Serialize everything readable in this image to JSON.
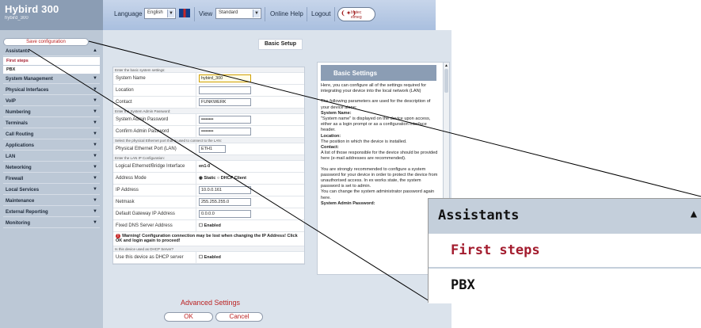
{
  "brand": {
    "title": "Hybird 300",
    "subtitle": "hybird_300"
  },
  "topbar": {
    "language_label": "Language",
    "language_value": "English",
    "view_label": "View",
    "view_value": "Standard",
    "online_help": "Online Help",
    "logout": "Logout",
    "logo_text": "bintec elmeg"
  },
  "sidebar": {
    "save_label": "Save configuration",
    "items": [
      {
        "label": "Assistants",
        "expanded": true
      },
      {
        "label": "System Management"
      },
      {
        "label": "Physical Interfaces"
      },
      {
        "label": "VoIP"
      },
      {
        "label": "Numbering"
      },
      {
        "label": "Terminals"
      },
      {
        "label": "Call Routing"
      },
      {
        "label": "Applications"
      },
      {
        "label": "LAN"
      },
      {
        "label": "Networking"
      },
      {
        "label": "Firewall"
      },
      {
        "label": "Local Services"
      },
      {
        "label": "Maintenance"
      },
      {
        "label": "External Reporting"
      },
      {
        "label": "Monitoring"
      }
    ],
    "subitems": [
      {
        "label": "First steps",
        "active": true
      },
      {
        "label": "PBX"
      }
    ]
  },
  "content": {
    "title": "Basic Setup",
    "section_system": "Enter the basic system settings:",
    "system_name_label": "System Name",
    "system_name_value": "hybird_300",
    "location_label": "Location",
    "location_value": "",
    "contact_label": "Contact",
    "contact_value": "FUNKWERK",
    "section_admin": "Enter the System Admin Password:",
    "admin_pw_label": "System Admin Password",
    "admin_pw_value": "••••••••",
    "confirm_pw_label": "Confirm Admin Password",
    "confirm_pw_value": "••••••••",
    "section_port": "Select the physical Ethernet port that is used to connect to the LAN:",
    "port_label": "Physical Ethernet Port (LAN)",
    "port_value": "ETH1",
    "section_lan": "Enter the LAN IP Configuration:",
    "bridge_label": "Logical Ethernet/Bridge Interface",
    "bridge_value": "en1-0",
    "address_mode_label": "Address Mode",
    "static_label": "Static",
    "dhcp_label": "DHCP Client",
    "ip_label": "IP Address",
    "ip_value": "10.0.0.161",
    "netmask_label": "Netmask",
    "netmask_value": "255.255.255.0",
    "gateway_label": "Default Gateway IP Address",
    "gateway_value": "0.0.0.0",
    "dns_label": "Fixed DNS Server Address",
    "dns_enabled": "Enabled",
    "warning": "Warning! Configuration connection may be lost when changing the IP Address! Click OK and login again to proceed!",
    "section_dhcp": "Is this device used as DHCP Server?",
    "dhcp_server_label": "Use this device as DHCP server",
    "dhcp_server_enabled": "Enabled",
    "advanced": "Advanced Settings",
    "ok": "OK",
    "cancel": "Cancel"
  },
  "help": {
    "title": "Basic Settings",
    "p1": "Here, you can configure all of the settings required for integrating your device into the local network (LAN)",
    "p2": "The following parameters are used for the description of your device alone:",
    "h_sysname": "System Name:",
    "p3": "\"System name\" is displayed on the device upon access, either as a login prompt or as a configuration interface header.",
    "h_location": "Location:",
    "p4": "The position in which the device is installed.",
    "h_contact": "Contact:",
    "p5": "A list of those responsible for the device should be provided here (e-mail addresses are recommended).",
    "p6": "You are strongly recommended to configure a system password for your device in order to protect the device from unauthorised access. In ex works state, the system password is set to admin.",
    "p7": "You can change the system administrator password again here.",
    "h_admin": "System Admin Password:"
  },
  "zoom": {
    "header": "Assistants",
    "item1": "First steps",
    "item2": "PBX"
  }
}
